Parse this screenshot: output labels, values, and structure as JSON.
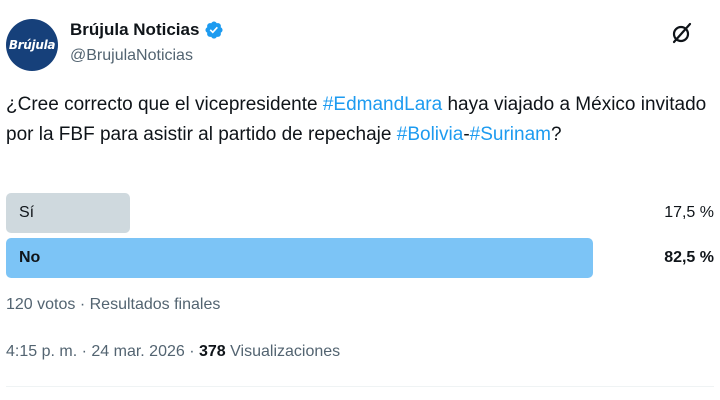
{
  "account": {
    "name": "Brújula Noticias",
    "handle": "@BrujulaNoticias",
    "avatar_text": "Brújula",
    "verified": true
  },
  "tweet": {
    "text_1": "¿Cree correcto que el vicepresidente ",
    "tag_1": "#EdmandLara",
    "text_2": " haya viajado a México invitado por la FBF para asistir al partido de repechaje ",
    "tag_2": "#Bolivia",
    "text_3": "-",
    "tag_3": "#Surinam",
    "text_4": "?"
  },
  "poll": {
    "options": [
      {
        "label": "Sí",
        "percent_text": "17,5 %",
        "percent": 17.5,
        "winner": false
      },
      {
        "label": "No",
        "percent_text": "82,5 %",
        "percent": 82.5,
        "winner": true
      }
    ],
    "votes_text": "120 votos",
    "separator": " · ",
    "status": "Resultados finales"
  },
  "timestamp": {
    "time": "4:15 p. m.",
    "separator": " · ",
    "date": "24 mar. 2026",
    "separator_2": " · ",
    "views_count": "378",
    "views_label": " Visualizaciones"
  },
  "colors": {
    "accent": "#1d9bf0",
    "winner_bar": "#7cc4f6",
    "loser_bar": "#cfd9de",
    "avatar_bg": "#16407a",
    "secondary_text": "#536471"
  },
  "icons": {
    "verified": "verified-badge-icon",
    "grok": "grok-icon"
  }
}
